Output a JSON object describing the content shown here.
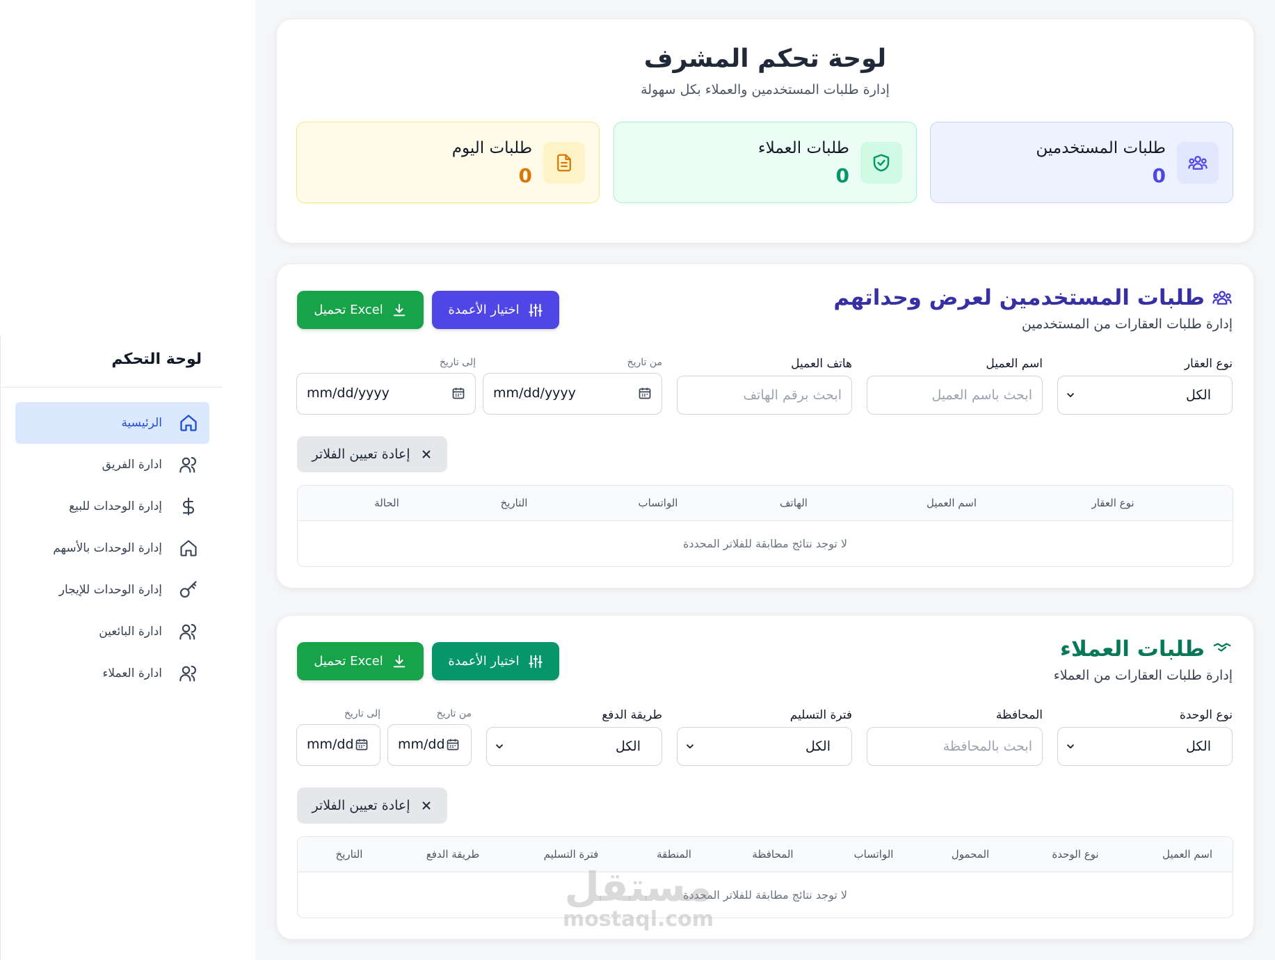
{
  "sidebar": {
    "title": "لوحة التحكم",
    "items": [
      {
        "label": "الرئيسية",
        "icon": "home-icon",
        "active": true
      },
      {
        "label": "ادارة الفريق",
        "icon": "users-icon"
      },
      {
        "label": "إدارة الوحدات للبيع",
        "icon": "dollar-icon"
      },
      {
        "label": "إدارة الوحدات بالأسهم",
        "icon": "home-icon"
      },
      {
        "label": "إدارة الوحدات للإيجار",
        "icon": "key-icon"
      },
      {
        "label": "ادارة البائعين",
        "icon": "users-icon"
      },
      {
        "label": "ادارة العملاء",
        "icon": "users-icon"
      }
    ]
  },
  "header": {
    "title": "لوحة تحكم المشرف",
    "subtitle": "إدارة طلبات المستخدمين والعملاء بكل سهولة",
    "stats": [
      {
        "label": "طلبات المستخدمين",
        "value": "0",
        "icon": "users-group-icon",
        "color": "#4f46e5"
      },
      {
        "label": "طلبات العملاء",
        "value": "0",
        "icon": "shield-check-icon",
        "color": "#059669"
      },
      {
        "label": "طلبات اليوم",
        "value": "0",
        "icon": "document-icon",
        "color": "#d97706"
      }
    ]
  },
  "user_requests": {
    "title": "طلبات المستخدمين لعرض وحداتهم",
    "subtitle": "إدارة طلبات العقارات من المستخدمين",
    "columns_button": "اختيار الأعمدة",
    "excel_button": "تحميل Excel",
    "filters": {
      "property_type_label": "نوع العقار",
      "property_type_value": "الكل",
      "client_name_label": "اسم العميل",
      "client_name_placeholder": "ابحث باسم العميل",
      "client_phone_label": "هاتف العميل",
      "client_phone_placeholder": "ابحث برقم الهاتف",
      "from_date_label": "من تاريخ",
      "from_date_value": "mm/dd/yyyy",
      "to_date_label": "إلى تاريخ",
      "to_date_value": "mm/dd/yyyy"
    },
    "reset_button": "إعادة تعيين الفلاتر",
    "table_headers": [
      "نوع العقار",
      "اسم العميل",
      "الهاتف",
      "الواتساب",
      "التاريخ",
      "الحالة"
    ],
    "empty_message": "لا توجد نتائج مطابقة للفلاتر المحددة"
  },
  "client_requests": {
    "title": "طلبات العملاء",
    "subtitle": "إدارة طلبات العقارات من العملاء",
    "columns_button": "اختيار الأعمدة",
    "excel_button": "تحميل Excel",
    "filters": {
      "unit_type_label": "نوع الوحدة",
      "unit_type_value": "الكل",
      "governorate_label": "المحافظة",
      "governorate_placeholder": "ابحث بالمحافظة",
      "delivery_label": "فترة التسليم",
      "delivery_value": "الكل",
      "payment_label": "طريقة الدفع",
      "payment_value": "الكل",
      "from_date_label": "من تاريخ",
      "from_date_value": "mm/dd",
      "to_date_label": "إلى تاريخ",
      "to_date_value": "mm/dd"
    },
    "reset_button": "إعادة تعيين الفلاتر",
    "table_headers": [
      "اسم العميل",
      "نوع الوحدة",
      "المحمول",
      "الواتساب",
      "المحافظة",
      "المنطقة",
      "فترة التسليم",
      "طريقة الدفع",
      "التاريخ"
    ],
    "empty_message": "لا توجد نتائج مطابقة للفلاتر المحددة"
  },
  "watermark": {
    "arabic": "مستقل",
    "latin": "mostaql.com"
  }
}
